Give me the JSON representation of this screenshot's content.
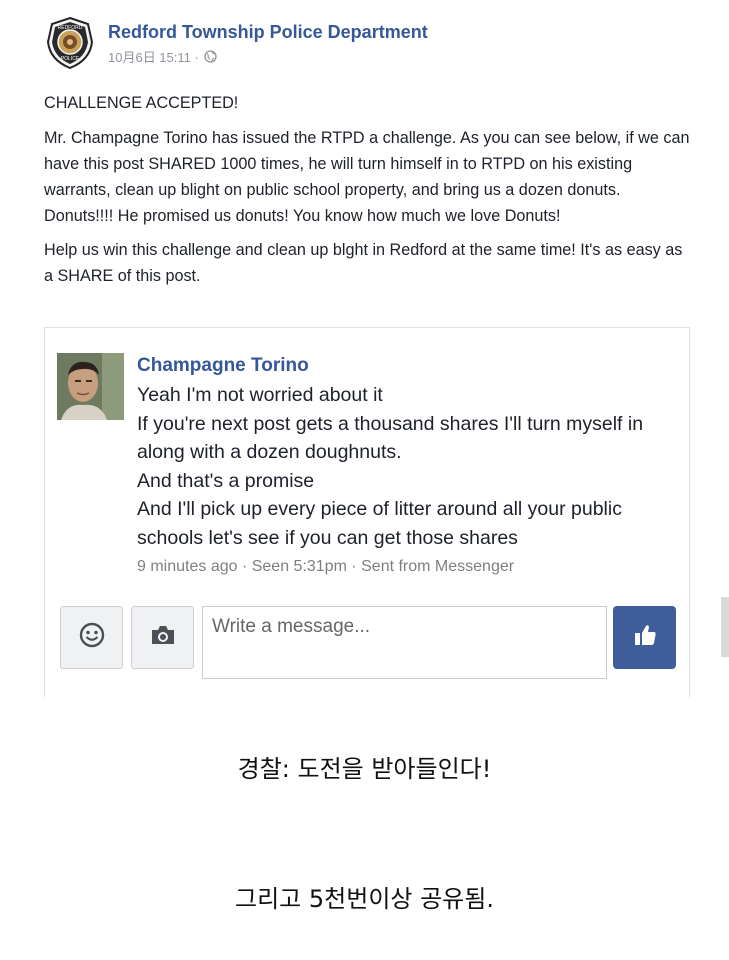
{
  "post": {
    "page_name": "Redford Township Police Department",
    "timestamp": "10月6日 15:11 ·",
    "privacy_icon": "globe-icon",
    "badge_text": {
      "top": "REDFORD",
      "bottom": "POLICE"
    },
    "paragraphs": [
      "CHALLENGE ACCEPTED!",
      "Mr. Champagne Torino has issued the RTPD a challenge. As you can see below, if we can have this post SHARED 1000 times, he will turn himself in to RTPD on his existing warrants, clean up blight on public school property, and bring us a dozen donuts. Donuts!!!! He promised us donuts! You know how much we love Donuts!",
      "Help us win this challenge and clean up blght in Redford at the same time! It's as easy as a SHARE of this post."
    ]
  },
  "chat": {
    "sender_name": "Champagne Torino",
    "lines": [
      "Yeah I'm not worried about it",
      "If you're next post gets a thousand shares I'll turn myself in along with a dozen doughnuts.",
      "And that's a promise",
      "And I'll pick up every piece of litter around all your public schools let's see if you can get those shares"
    ],
    "meta": "9 minutes ago · Seen 5:31pm · Sent from Messenger",
    "input_placeholder": "Write a message...",
    "colors": {
      "name": "#365899",
      "like_button": "#3f5d9b"
    }
  },
  "captions": [
    "경찰: 도전을 받아들인다!",
    "그리고 5천번이상 공유됨."
  ]
}
